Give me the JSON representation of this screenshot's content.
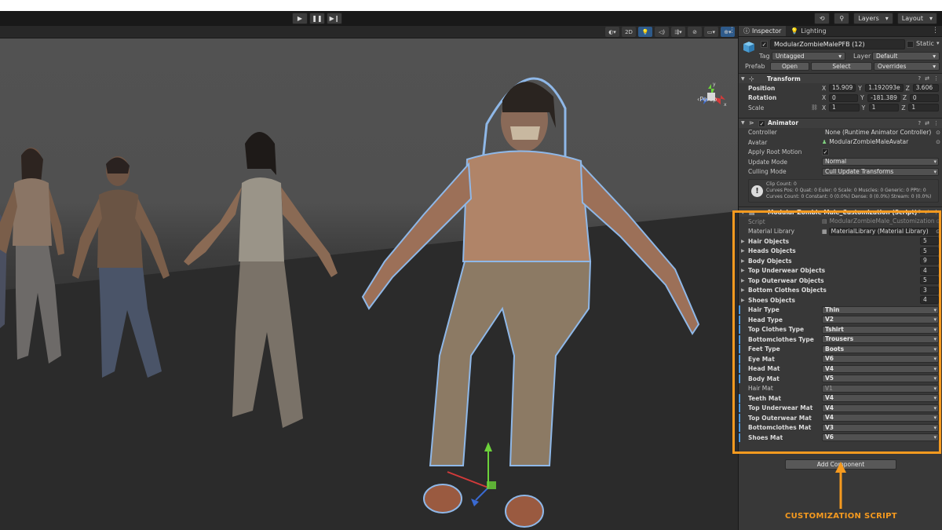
{
  "toolbar": {
    "play_icon": "play-icon",
    "pause_icon": "pause-icon",
    "step_icon": "step-icon",
    "history_icon": "history-icon",
    "search_icon": "search-icon",
    "layers_label": "Layers",
    "layout_label": "Layout"
  },
  "scene": {
    "toolbar_2d": "2D",
    "persp_label": "‹Persp",
    "axis_labels": {
      "y": "y",
      "x": "x"
    }
  },
  "inspector": {
    "tabs": [
      {
        "label": "Inspector",
        "icon": "info-icon"
      },
      {
        "label": "Lighting",
        "icon": "bulb-icon"
      }
    ],
    "object": {
      "name": "ModularZombieMalePFB (12)",
      "static_label": "Static",
      "tag_label": "Tag",
      "tag_value": "Untagged",
      "layer_label": "Layer",
      "layer_value": "Default",
      "prefab_label": "Prefab",
      "open_label": "Open",
      "select_label": "Select",
      "overrides_label": "Overrides"
    },
    "transform": {
      "title": "Transform",
      "position_label": "Position",
      "rotation_label": "Rotation",
      "scale_label": "Scale",
      "position": {
        "x": "15.909",
        "y": "1.192093е",
        "z": "3.606"
      },
      "rotation": {
        "x": "0",
        "y": "-181.389",
        "z": "0"
      },
      "scale": {
        "x": "1",
        "y": "1",
        "z": "1"
      }
    },
    "animator": {
      "title": "Animator",
      "controller_label": "Controller",
      "controller_value": "None (Runtime Animator Controller)",
      "avatar_label": "Avatar",
      "avatar_value": "ModularZombieMaleAvatar",
      "apply_root_label": "Apply Root Motion",
      "update_mode_label": "Update Mode",
      "update_mode_value": "Normal",
      "culling_label": "Culling Mode",
      "culling_value": "Cull Update Transforms",
      "info_line1": "Clip Count: 0",
      "info_line2": "Curves Pos: 0 Quat: 0 Euler: 0 Scale: 0 Muscles: 0 Generic: 0 PPtr: 0",
      "info_line3": "Curves Count: 0 Constant: 0 (0.0%) Dense: 0 (0.0%) Stream: 0 (0.0%)"
    },
    "customization": {
      "title": "Modular Zombie Male_Customization (Script)",
      "script_label": "Script",
      "script_value": "ModularZombieMale_Customization",
      "material_library_label": "Material Library",
      "material_library_value": "MaterialLibrary (Material Library)",
      "object_lists": [
        {
          "label": "Hair Objects",
          "count": "5"
        },
        {
          "label": "Heads Objects",
          "count": "5"
        },
        {
          "label": "Body Objects",
          "count": "9"
        },
        {
          "label": "Top Underwear Objects",
          "count": "4"
        },
        {
          "label": "Top Outerwear Objects",
          "count": "5"
        },
        {
          "label": "Bottom Clothes Objects",
          "count": "3"
        },
        {
          "label": "Shoes Objects",
          "count": "4"
        }
      ],
      "selections": [
        {
          "label": "Hair Type",
          "value": "Thin",
          "modified": true
        },
        {
          "label": "Head Type",
          "value": "V2",
          "modified": true
        },
        {
          "label": "Top Clothes Type",
          "value": "Tshirt",
          "modified": true
        },
        {
          "label": "Bottomclothes Type",
          "value": "Trousers",
          "modified": true
        },
        {
          "label": "Feet Type",
          "value": "Boots",
          "modified": true
        },
        {
          "label": "Eye Mat",
          "value": "V6",
          "modified": true
        },
        {
          "label": "Head Mat",
          "value": "V4",
          "modified": true
        },
        {
          "label": "Body Mat",
          "value": "V5",
          "modified": true
        },
        {
          "label": "Hair Mat",
          "value": "V1",
          "modified": false
        },
        {
          "label": "Teeth Mat",
          "value": "V4",
          "modified": true
        },
        {
          "label": "Top Underwear Mat",
          "value": "V4",
          "modified": true
        },
        {
          "label": "Top Outerwear Mat",
          "value": "V4",
          "modified": true
        },
        {
          "label": "Bottomclothes Mat",
          "value": "V3",
          "modified": true
        },
        {
          "label": "Shoes Mat",
          "value": "V6",
          "modified": true
        }
      ]
    },
    "add_component_label": "Add Component"
  },
  "annotation": {
    "label": "CUSTOMIZATION SCRIPT",
    "color": "#f59a1f"
  }
}
